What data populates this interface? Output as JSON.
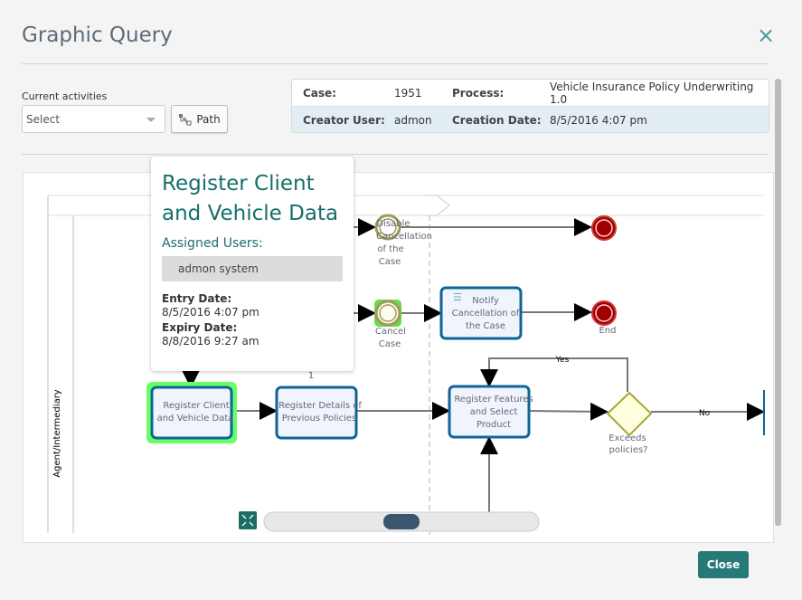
{
  "dialog": {
    "title": "Graphic Query",
    "close_label": "Close",
    "close_icon": "x-icon"
  },
  "filters": {
    "current_activities_label": "Current activities",
    "select_value": "Select",
    "path_label": "Path"
  },
  "info": {
    "case_label": "Case:",
    "case_value": "1951",
    "process_label": "Process:",
    "process_value": "Vehicle Insurance Policy Underwriting 1.0",
    "creator_label": "Creator User:",
    "creator_value": "admon",
    "creation_date_label": "Creation Date:",
    "creation_date_value": "8/5/2016 4:07 pm"
  },
  "tooltip": {
    "title": "Register Client and Vehicle Data",
    "assigned_label": "Assigned Users:",
    "users": "admon system",
    "entry_label": "Entry Date:",
    "entry_value": "8/5/2016 4:07 pm",
    "expiry_label": "Expiry Date:",
    "expiry_value": "8/8/2016 9:27 am"
  },
  "diagram": {
    "lane": "Agent/Intermediary",
    "events": {
      "disable": [
        "Disable",
        "Cancellation",
        "of the",
        "Case"
      ],
      "cancel": [
        "Cancel",
        "Case"
      ],
      "end": "End"
    },
    "tasks": {
      "notify": [
        "Notify",
        "Cancellation of",
        "the Case"
      ],
      "client": [
        "Register Client",
        "and Vehicle Data"
      ],
      "details": [
        "Register Details of",
        "Previous Policies"
      ],
      "features": [
        "Register Features",
        "and Select",
        "Product"
      ]
    },
    "gateway": [
      "Exceeds",
      "policies?"
    ],
    "flows": {
      "yes": "Yes",
      "no": "No"
    },
    "count": "1",
    "colors": {
      "task_border": "#0e6596",
      "task_fill": "#f0f4fd",
      "active": "#66ff66",
      "event": "#9e9a5c",
      "end": "#a00000",
      "gateway": "#a8a832"
    }
  }
}
